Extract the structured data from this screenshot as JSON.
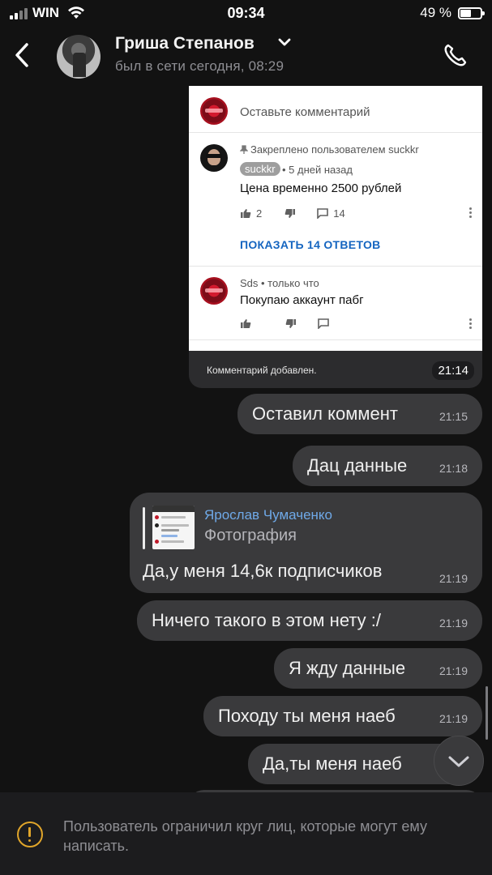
{
  "status_bar": {
    "carrier": "WIN",
    "time": "09:34",
    "battery": "49 %",
    "battery_level": 0.49
  },
  "header": {
    "contact_name": "Гриша Степанов",
    "last_seen": "был в сети сегодня, 08:29",
    "icons": [
      "back-icon",
      "chevron-down-icon",
      "phone-icon"
    ]
  },
  "photo_message": {
    "screenshot": {
      "comment_placeholder": "Оставьте комментарий",
      "pinned_label": "Закреплено пользователем suckkr",
      "author": "suckkr",
      "posted": "• 5 дней назад",
      "comment_text": "Цена временно 2500 рублей",
      "likes": "2",
      "replies_count": "14",
      "show_replies": "ПОКАЗАТЬ 14 ОТВЕТОВ",
      "second_meta": "Sds • только что",
      "second_text": "Покупаю аккаунт пабг"
    },
    "toast": "Комментарий добавлен.",
    "time": "21:14"
  },
  "messages": [
    {
      "text": "Оставил коммент",
      "time": "21:15"
    },
    {
      "text": "Дац данные",
      "time": "21:18"
    },
    {
      "text": "Ничего такого в этом нету :/",
      "time": "21:19"
    },
    {
      "text": "Я жду данные",
      "time": "21:19"
    },
    {
      "text": "Походу ты меня наеб",
      "time": "21:19"
    },
    {
      "text": "Да,ты меня наеб",
      "time": ""
    }
  ],
  "reply_message": {
    "quoted_author": "Ярослав Чумаченко",
    "quoted_type": "Фотография",
    "text": "Да,у меня 14,6к подписчиков",
    "time": "21:19"
  },
  "footer": {
    "notice": "Пользователь ограничил круг лиц, которые могут ему написать."
  },
  "colors": {
    "background": "#121212",
    "bubble": "#3a3a3c",
    "link_blue": "#6fa9e8",
    "warning": "#e0a52a",
    "youtube_link": "#1565c0"
  }
}
